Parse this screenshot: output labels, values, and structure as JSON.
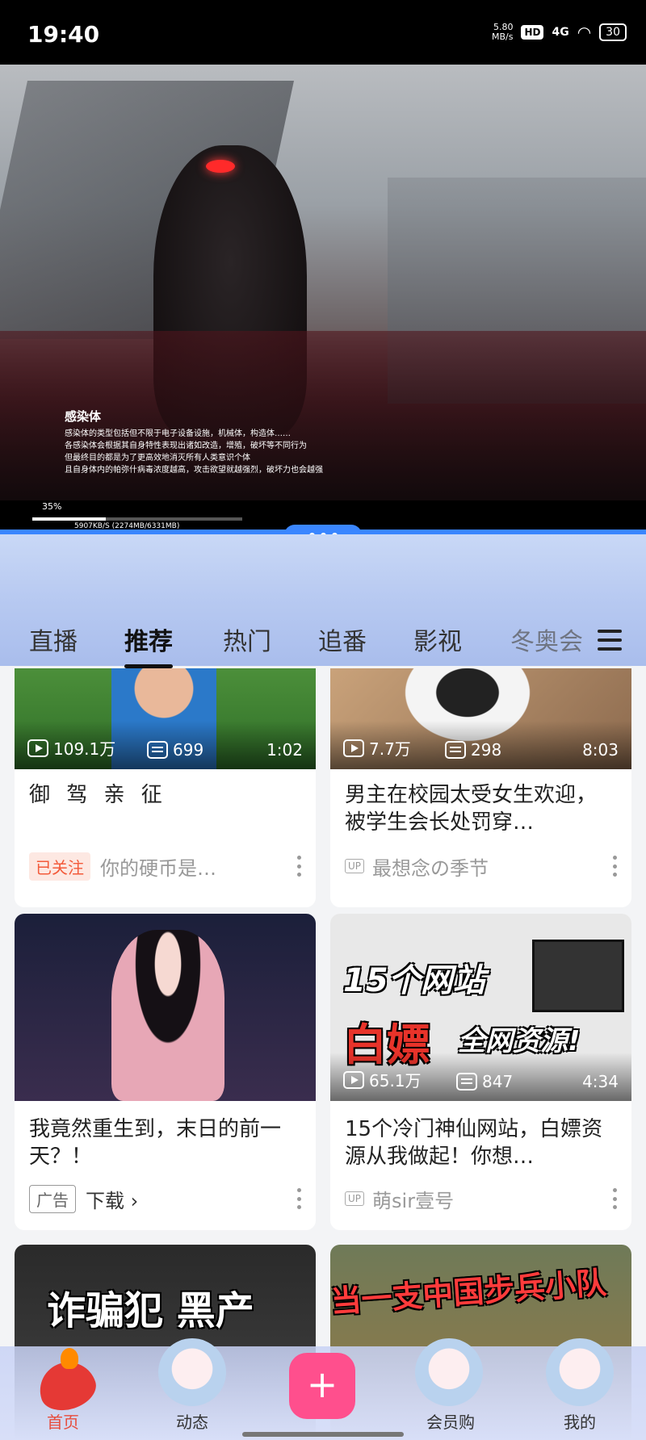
{
  "status_bar": {
    "time": "19:40",
    "speed_value": "5.80",
    "speed_unit": "MB/s",
    "hd": "HD",
    "network": "4G",
    "battery": "30"
  },
  "player": {
    "title": "感染体",
    "description": "感染体的类型包括但不限于电子设备设施，机械体，构造体……\n各感染体会根据其自身特性表现出诸如改造，增殖，破坏等不同行为\n但最终目的都是为了更高效地消灭所有人类意识个体\n且自身体内的帕弥什病毒浓度越高，攻击欲望就越强烈，破坏力也会越强",
    "progress_percent_label": "35%",
    "progress": 0.35,
    "download_info": "5907KB/S   (2274MB/6331MB)"
  },
  "tabs": [
    {
      "label": "直播"
    },
    {
      "label": "推荐"
    },
    {
      "label": "热门"
    },
    {
      "label": "追番"
    },
    {
      "label": "影视"
    },
    {
      "label": "冬奥会"
    }
  ],
  "cards": [
    {
      "views": "109.1万",
      "danmaku": "699",
      "duration": "1:02",
      "title": "御 驾 亲 征",
      "badge": "已关注",
      "meta": "你的硬币是…"
    },
    {
      "views": "7.7万",
      "danmaku": "298",
      "duration": "8:03",
      "title": "男主在校园太受女生欢迎，被学生会长处罚穿…",
      "badge": "UP",
      "meta": "最想念の季节"
    },
    {
      "title": "我竟然重生到，末日的前一天？！",
      "badge": "广告",
      "meta": "下载 ›"
    },
    {
      "views": "65.1万",
      "danmaku": "847",
      "duration": "4:34",
      "title": "15个冷门神仙网站，白嫖资源从我做起！你想…",
      "badge": "UP",
      "meta": "萌sir壹号",
      "overlay_line1": "15个网站",
      "overlay_line2a": "白嫖",
      "overlay_line2b": "全网资源!"
    },
    {
      "overlay": "诈骗犯 黑产"
    },
    {
      "overlay": "当一支中国步兵小队"
    }
  ],
  "bottom_nav": [
    {
      "label": "首页"
    },
    {
      "label": "动态"
    },
    {
      "label": "+"
    },
    {
      "label": "会员购"
    },
    {
      "label": "我的"
    }
  ],
  "colors": {
    "accent_pink": "#ff4f8d",
    "player_divider": "#3a86ff",
    "follow_badge": "#f35a3a"
  }
}
